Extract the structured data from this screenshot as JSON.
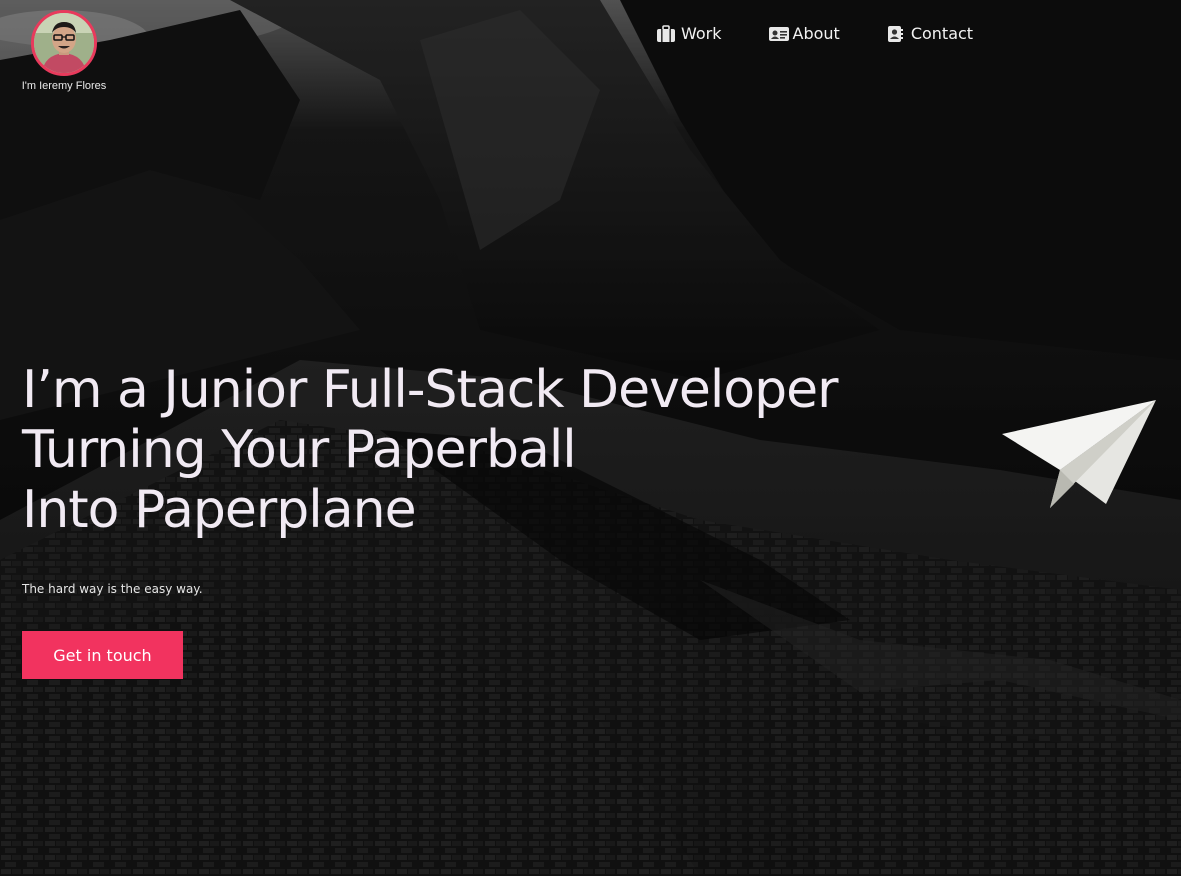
{
  "brand": {
    "name": "I'm Ieremy Flores"
  },
  "nav": {
    "items": [
      {
        "label": "Work",
        "icon": "briefcase-icon"
      },
      {
        "label": "About",
        "icon": "id-card-icon"
      },
      {
        "label": "Contact",
        "icon": "address-book-icon"
      }
    ]
  },
  "hero": {
    "headline_lines": [
      "I’m a Junior Full-Stack Developer",
      "Turning Your Paperball",
      "Into Paperplane"
    ],
    "tagline": "The hard way is the easy way.",
    "cta_label": "Get in touch",
    "decoration_icon": "paper-plane-icon"
  },
  "colors": {
    "accent": "#f2335f",
    "avatar_border": "#e83a5c",
    "headline": "#f1eaf3",
    "background": "#000000"
  }
}
